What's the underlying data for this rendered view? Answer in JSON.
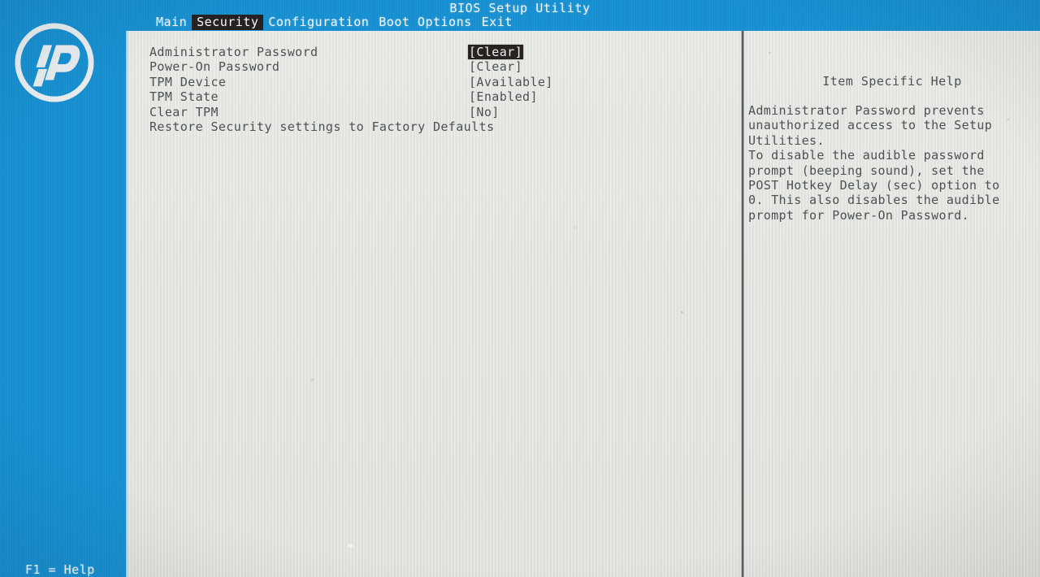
{
  "colors": {
    "background_blue": "#1690d2",
    "panel_gray": "#e4e5e1",
    "text_gray": "#4a4f52",
    "highlight_bg": "#25201f",
    "highlight_fg": "#f4f4f4",
    "divider": "#4b5052"
  },
  "header": {
    "title": "BIOS Setup Utility",
    "logo_alt": "hp"
  },
  "menubar": {
    "items": [
      {
        "label": "Main",
        "selected": false
      },
      {
        "label": "Security",
        "selected": true
      },
      {
        "label": "Configuration",
        "selected": false
      },
      {
        "label": "Boot Options",
        "selected": false
      },
      {
        "label": "Exit",
        "selected": false
      }
    ]
  },
  "settings": {
    "rows": [
      {
        "label": "Administrator Password",
        "value": "[Clear]",
        "highlighted": true
      },
      {
        "label": "Power-On Password",
        "value": "[Clear]",
        "highlighted": false
      },
      {
        "label": "TPM Device",
        "value": "[Available]",
        "highlighted": false
      },
      {
        "label": "TPM State",
        "value": "[Enabled]",
        "highlighted": false
      },
      {
        "label": "Clear TPM",
        "value": "[No]",
        "highlighted": false
      },
      {
        "label": "Restore Security settings to Factory Defaults",
        "value": "",
        "highlighted": false
      }
    ]
  },
  "help": {
    "title": "Item Specific Help",
    "lines": [
      "Administrator Password prevents",
      "unauthorized access to the Setup",
      "Utilities.",
      "To disable the audible password",
      "prompt (beeping sound), set the",
      "POST Hotkey Delay (sec) option to",
      "0. This also disables the audible",
      "prompt for Power-On Password."
    ]
  },
  "footer": {
    "hint": "F1 = Help"
  }
}
